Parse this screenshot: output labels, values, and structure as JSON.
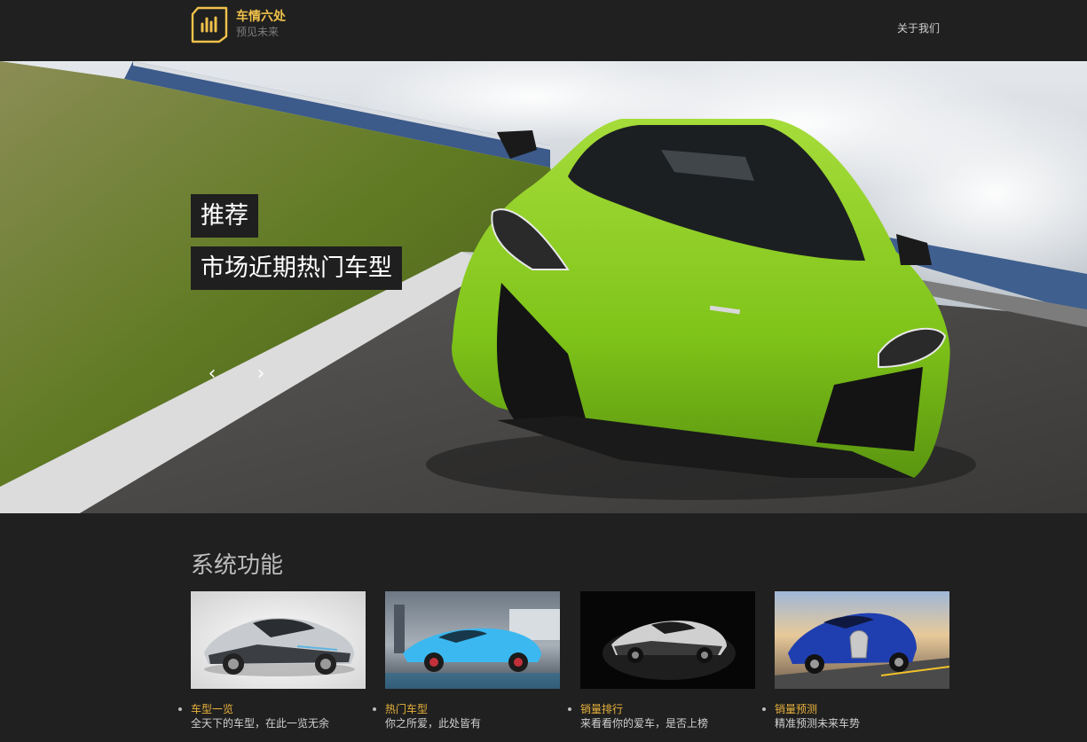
{
  "header": {
    "logo_title": "车情六处",
    "logo_subtitle": "预见未来",
    "nav_about": "关于我们"
  },
  "hero": {
    "tag": "推荐",
    "title": "市场近期热门车型",
    "prev_symbol": "‹",
    "next_symbol": "›"
  },
  "features": {
    "title": "系统功能",
    "cards": [
      {
        "label": "车型一览",
        "desc": "全天下的车型，在此一览无余"
      },
      {
        "label": "热门车型",
        "desc": "你之所爱，此处皆有"
      },
      {
        "label": "销量排行",
        "desc": "来看看你的爱车，是否上榜"
      },
      {
        "label": "销量预测",
        "desc": "精准预测未来车势"
      }
    ]
  },
  "colors": {
    "page_bg": "#202020",
    "accent": "#f0c24b",
    "link": "#e8b23c"
  },
  "icons": [
    "logo-icon",
    "chevron-left-icon",
    "chevron-right-icon"
  ]
}
